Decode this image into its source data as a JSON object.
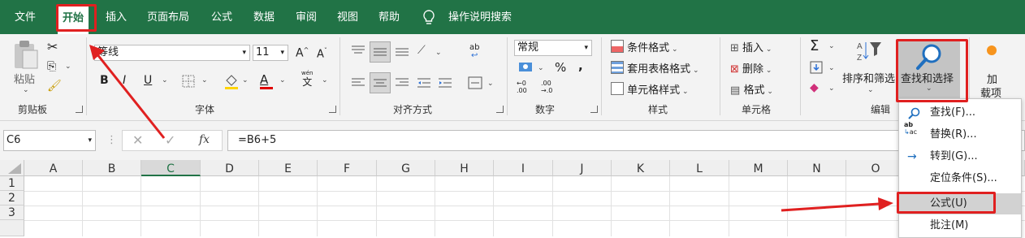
{
  "tabs": {
    "file": "文件",
    "home": "开始",
    "insert": "插入",
    "page_layout": "页面布局",
    "formulas": "公式",
    "data": "数据",
    "review": "审阅",
    "view": "视图",
    "help": "帮助",
    "tell_me": "操作说明搜索"
  },
  "ribbon": {
    "clipboard": {
      "label": "剪贴板",
      "paste": "粘贴"
    },
    "font": {
      "label": "字体",
      "font_name": "等线",
      "font_size": "11",
      "bold": "B",
      "italic": "I",
      "underline": "U",
      "font_color_glyph": "A",
      "wen_top": "wén",
      "wen_char": "文",
      "grow": "A",
      "shrink": "A"
    },
    "alignment": {
      "label": "对齐方式",
      "wrap_glyph": "ab"
    },
    "number": {
      "label": "数字",
      "format": "常规",
      "percent": "%",
      "comma": ",",
      "inc_dec": "←0 .00",
      "dec_dec": ".00 →.0"
    },
    "styles": {
      "label": "样式",
      "conditional": "条件格式",
      "table": "套用表格格式",
      "cell_styles": "单元格样式"
    },
    "cells": {
      "label": "单元格",
      "insert": "插入",
      "delete": "删除",
      "format": "格式"
    },
    "editing": {
      "label": "编辑",
      "sum": "Σ",
      "sort_filter": "排序和筛选",
      "find_select": "查找和选择"
    },
    "addins": {
      "label_line1": "加",
      "label_line2": "载项"
    }
  },
  "formula_bar": {
    "name_box": "C6",
    "fx": "fx",
    "formula": "=B6+5"
  },
  "grid": {
    "columns": [
      "A",
      "B",
      "C",
      "D",
      "E",
      "F",
      "G",
      "H",
      "I",
      "J",
      "K",
      "L",
      "M",
      "N",
      "O"
    ],
    "rows": [
      "1",
      "2",
      "3"
    ]
  },
  "menu": {
    "items": [
      {
        "label": "查找(F)...",
        "icon": "search-icon"
      },
      {
        "label": "替换(R)...",
        "icon": "replace-icon"
      },
      {
        "label": "转到(G)...",
        "icon": "arrow-right-icon"
      },
      {
        "label": "定位条件(S)...",
        "icon": ""
      },
      {
        "label": "公式(U)",
        "icon": ""
      },
      {
        "label": "批注(M)",
        "icon": ""
      }
    ]
  },
  "colors": {
    "excel_green": "#217346",
    "annotation_red": "#e02020"
  }
}
